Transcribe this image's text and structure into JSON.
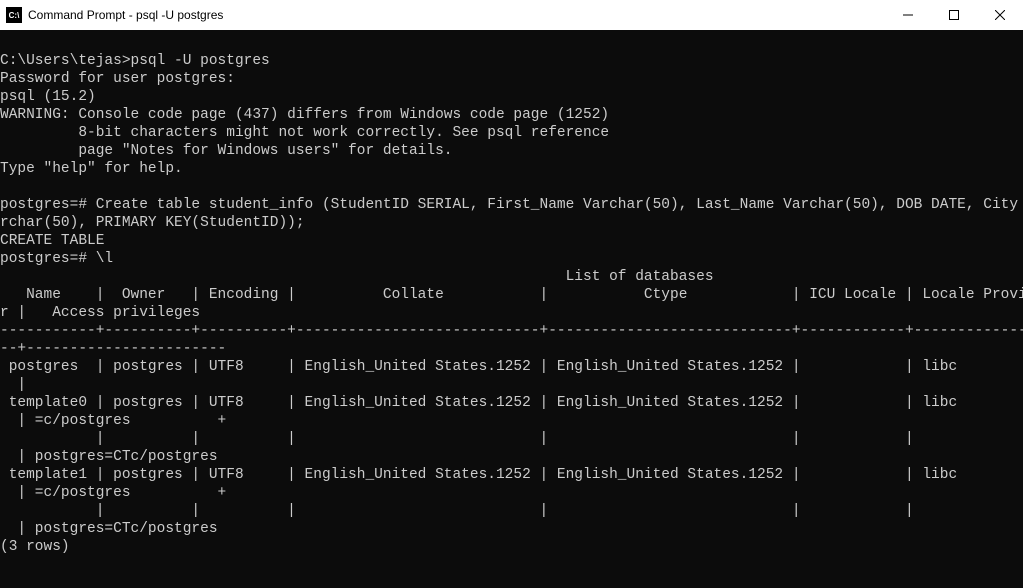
{
  "window": {
    "title": "Command Prompt - psql  -U postgres"
  },
  "session": {
    "prompt_line": "C:\\Users\\tejas>psql -U postgres",
    "password_line": "Password for user postgres:",
    "version_line": "psql (15.2)",
    "warning_l1": "WARNING: Console code page (437) differs from Windows code page (1252)",
    "warning_l2": "         8-bit characters might not work correctly. See psql reference",
    "warning_l3": "         page \"Notes for Windows users\" for details.",
    "help_line": "Type \"help\" for help.",
    "blank": "",
    "sql_create_l1": "postgres=# Create table student_info (StudentID SERIAL, First_Name Varchar(50), Last_Name Varchar(50), DOB DATE, City Va",
    "sql_create_l2": "rchar(50), PRIMARY KEY(StudentID));",
    "create_result": "CREATE TABLE",
    "list_cmd": "postgres=# \\l"
  },
  "db_list": {
    "header_title": "                                                                 List of databases",
    "header_cols": "   Name    |  Owner   | Encoding |          Collate           |           Ctype            | ICU Locale | Locale Provide",
    "header_cols2": "r |   Access privileges",
    "sep": "-----------+----------+----------+----------------------------+----------------------------+------------+---------------",
    "sep2": "--+-----------------------",
    "row1_l1": " postgres  | postgres | UTF8     | English_United States.1252 | English_United States.1252 |            | libc",
    "row1_l2": "  |",
    "row2_l1": " template0 | postgres | UTF8     | English_United States.1252 | English_United States.1252 |            | libc",
    "row2_l2": "  | =c/postgres          +",
    "row2_l3": "           |          |          |                            |                            |            |",
    "row2_l4": "  | postgres=CTc/postgres",
    "row3_l1": " template1 | postgres | UTF8     | English_United States.1252 | English_United States.1252 |            | libc",
    "row3_l2": "  | =c/postgres          +",
    "row3_l3": "           |          |          |                            |                            |            |",
    "row3_l4": "  | postgres=CTc/postgres",
    "footer": "(3 rows)"
  },
  "chart_data": {
    "type": "table",
    "title": "List of databases",
    "columns": [
      "Name",
      "Owner",
      "Encoding",
      "Collate",
      "Ctype",
      "ICU Locale",
      "Locale Provider",
      "Access privileges"
    ],
    "rows": [
      {
        "Name": "postgres",
        "Owner": "postgres",
        "Encoding": "UTF8",
        "Collate": "English_United States.1252",
        "Ctype": "English_United States.1252",
        "ICU Locale": "",
        "Locale Provider": "libc",
        "Access privileges": ""
      },
      {
        "Name": "template0",
        "Owner": "postgres",
        "Encoding": "UTF8",
        "Collate": "English_United States.1252",
        "Ctype": "English_United States.1252",
        "ICU Locale": "",
        "Locale Provider": "libc",
        "Access privileges": "=c/postgres\npostgres=CTc/postgres"
      },
      {
        "Name": "template1",
        "Owner": "postgres",
        "Encoding": "UTF8",
        "Collate": "English_United States.1252",
        "Ctype": "English_United States.1252",
        "ICU Locale": "",
        "Locale Provider": "libc",
        "Access privileges": "=c/postgres\npostgres=CTc/postgres"
      }
    ],
    "row_count": 3
  }
}
